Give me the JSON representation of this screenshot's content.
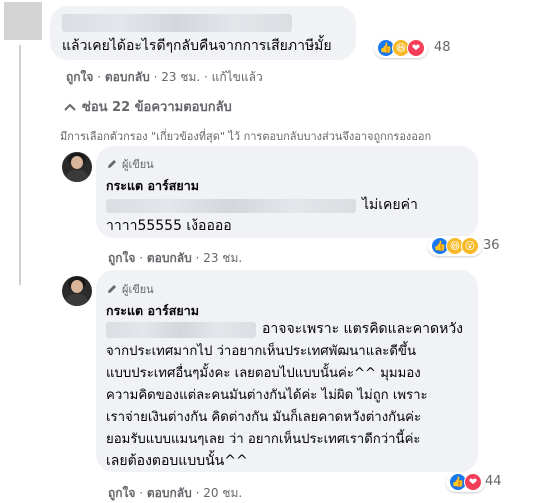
{
  "top_comment": {
    "text": "แล้วเคยได้อะไรดีๆกลับคืนจากการเสียภาษีมั้ย",
    "reaction_count": "48",
    "reactions": [
      "like-icon",
      "haha-icon",
      "love-icon"
    ],
    "actions": {
      "like": "ถูกใจ",
      "reply": "ตอบกลับ",
      "time": "23 ชม.",
      "edited": "แก้ไขแล้ว"
    }
  },
  "replies_toggle": {
    "label": "ซ่อน 22 ข้อความตอบกลับ"
  },
  "filter_notice": "มีการเลือกตัวกรอง \"เกี่ยวข้องที่สุด\" ไว้ การตอบกลับบางส่วนจึงอาจถูกกรองออก",
  "reply1": {
    "author_badge": "ผู้เขียน",
    "name": "กระแต อาร์สยาม",
    "line1_tail": "ไม่เคยค่า",
    "line2": "าาาา55555 เง้ออออ",
    "reaction_count": "36",
    "reactions": [
      "like-icon",
      "haha-icon",
      "wow-icon"
    ],
    "actions": {
      "like": "ถูกใจ",
      "reply": "ตอบกลับ",
      "time": "23 ชม."
    }
  },
  "reply2": {
    "author_badge": "ผู้เขียน",
    "name": "กระแต อาร์สยาม",
    "lines": [
      "อาจจะเพราะ แตรคิดและคาดหวัง",
      "จากประเทศมากไป ว่าอยากเห็นประเทศพัฒนาและดีขึ้น",
      "แบบประเทศอื่นๆมั้งคะ เลยตอบไปแบบนั้นค่ะ^^ มุมมอง",
      "ความคิดของแต่ละคนมันต่างกันได้ค่ะ ไม่ผิด ไม่ถูก เพราะ",
      "เราจ่ายเงินต่างกัน คิดต่างกัน มันก็เลยคาดหวังต่างกันค่ะ",
      "ยอมรับแบบแมนๆเลย ว่า อยากเห็นประเทศเราดีกว่านี้ค่ะ",
      "เลยต้องตอบแบบนั้น^^"
    ],
    "reaction_count": "44",
    "reactions": [
      "like-icon",
      "love-icon"
    ],
    "actions": {
      "like": "ถูกใจ",
      "reply": "ตอบกลับ",
      "time": "20 ชม."
    }
  },
  "colors": {
    "bubble": "#f0f2f5",
    "like": "#1877f2",
    "love": "#f33e58",
    "haha": "#f7b928",
    "meta": "#65676b"
  }
}
